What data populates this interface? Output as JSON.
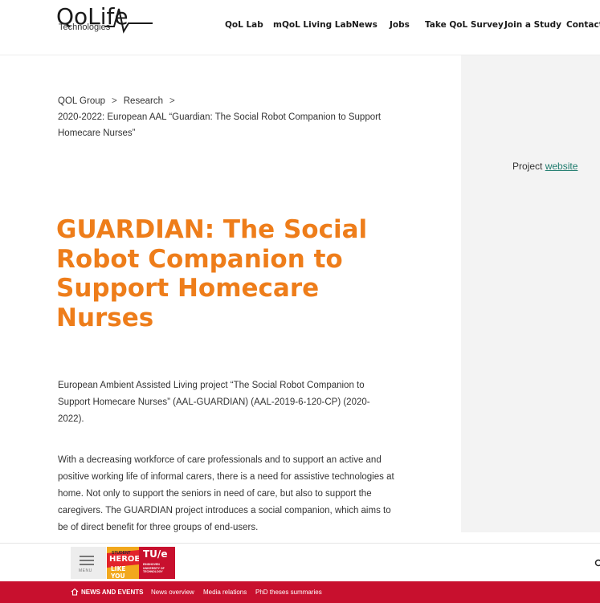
{
  "brand": {
    "logo_text": "QoLife",
    "logo_subtitle": "Technologies"
  },
  "nav": [
    "QoL Lab",
    "mQoL Living Lab",
    "News",
    "Jobs",
    "Take QoL Survey",
    "Join a Study",
    "Contact"
  ],
  "breadcrumb": {
    "items": [
      "QOL Group",
      "Research"
    ],
    "separator": ">",
    "current": "2020-2022: European AAL “Guardian: The Social Robot Companion to Support Homecare Nurses”"
  },
  "title": "GUARDIAN: The Social Robot Companion to Support Homecare Nurses",
  "paragraphs": [
    "European Ambient Assisted Living project “The Social Robot Companion to Support Homecare Nurses” (AAL-GUARDIAN) (AAL-2019-6-120-CP) (2020-2022).",
    "With a decreasing workforce of care professionals and to support an active and positive working life of informal carers, there is a need for assistive technologies at home. Not only to support the seniors in need of care, but also to support the caregivers. The GUARDIAN project introduces a social companion, which aims to be of direct benefit for three groups of end-users."
  ],
  "sidebar": {
    "project_prefix": "Project",
    "project_link": "website"
  },
  "footer": {
    "menu_label": "MENU",
    "heroes_kicker": "STUDENT",
    "heroes_line1": "HEROES",
    "heroes_line2": "LIKE YOU",
    "tue_logo": "TU/e",
    "tue_caption": "EINDHOVEN UNIVERSITY OF TECHNOLOGY",
    "news_section": "NEWS AND EVENTS",
    "news_links": [
      "News overview",
      "Media relations",
      "PhD theses summaries"
    ]
  },
  "colors": {
    "accent": "#ee7d1a",
    "link": "#1e7b6d",
    "footer_red": "#c8102e",
    "sidebar_bg": "#f3f3f3"
  }
}
